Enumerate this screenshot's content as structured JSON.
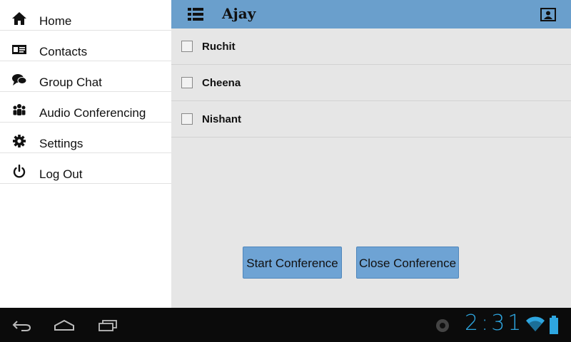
{
  "sidebar": {
    "items": [
      {
        "label": "Home",
        "icon": "home-icon"
      },
      {
        "label": "Contacts",
        "icon": "contacts-card-icon"
      },
      {
        "label": "Group Chat",
        "icon": "chat-bubbles-icon"
      },
      {
        "label": "Audio Conferencing",
        "icon": "group-users-icon"
      },
      {
        "label": "Settings",
        "icon": "gear-icon"
      },
      {
        "label": "Log Out",
        "icon": "power-icon"
      }
    ]
  },
  "header": {
    "title": "Ajay",
    "menu_icon": "list-menu-icon",
    "profile_icon": "profile-card-icon"
  },
  "contacts": [
    {
      "name": "Ruchit",
      "checked": false
    },
    {
      "name": "Cheena",
      "checked": false
    },
    {
      "name": "Nishant",
      "checked": false
    }
  ],
  "buttons": {
    "start": "Start Conference",
    "close": "Close Conference"
  },
  "status": {
    "time": "2:31"
  },
  "colors": {
    "header_bg": "#6a9fcc",
    "button_bg": "#6ea3d4",
    "content_bg": "#e6e6e6",
    "clock": "#2ea6e0"
  }
}
